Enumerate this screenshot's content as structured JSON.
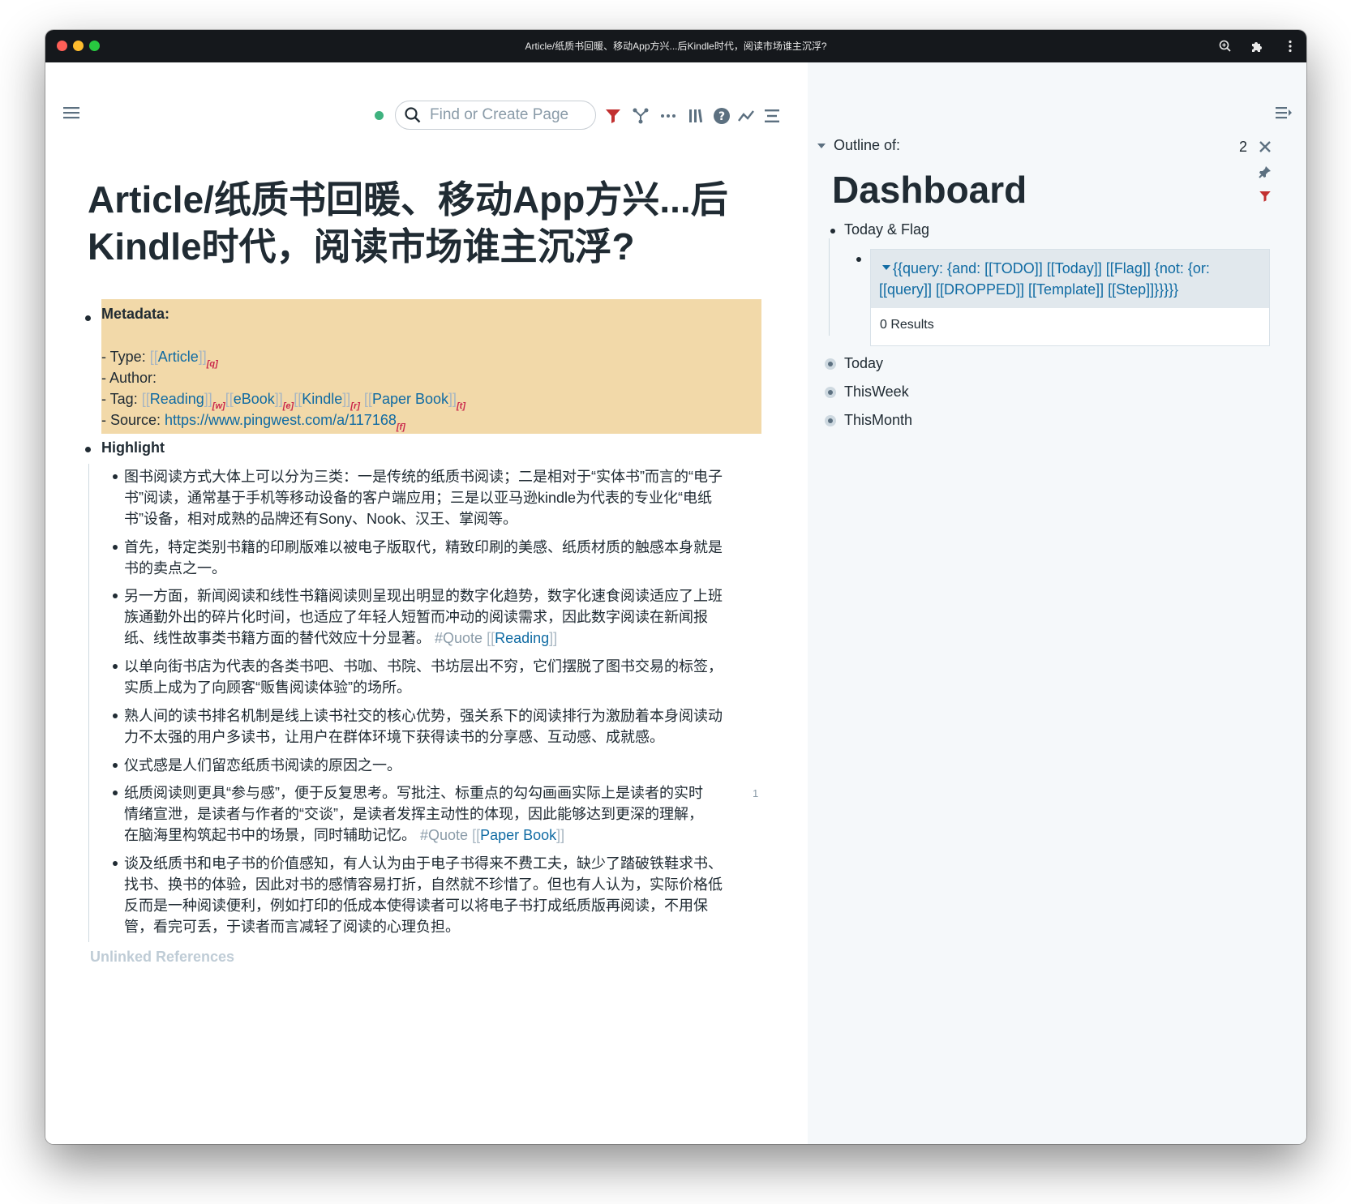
{
  "window": {
    "title": "Article/纸质书回暖、移动App方兴...后Kindle时代，阅读市场谁主沉浮?"
  },
  "topbar": {
    "search_placeholder": "Find or Create Page",
    "status_color": "#3fb27f",
    "filter_color": "#c23030"
  },
  "page": {
    "title": "Article/纸质书回暖、移动App方兴...后Kindle时代，阅读市场谁主沉浮?",
    "metadata": {
      "label": "Metadata:",
      "type_prefix": "- Type: ",
      "type_value": "Article",
      "type_note": "[q]",
      "author": "- Author:",
      "tag_prefix": "- Tag: ",
      "tags": [
        {
          "name": "Reading",
          "note": "[w]"
        },
        {
          "name": "eBook",
          "note": "[e]"
        },
        {
          "name": "Kindle",
          "note": "[r]"
        },
        {
          "name": "Paper Book",
          "note": "[t]"
        }
      ],
      "source_prefix": "- Source: ",
      "source_url": "https://www.pingwest.com/a/117168",
      "source_note": "[f]"
    },
    "highlight_label": "Highlight",
    "items": [
      {
        "text": "图书阅读方式大体上可以分为三类：一是传统的纸质书阅读；二是相对于“实体书”而言的“电子书”阅读，通常基于手机等移动设备的客户端应用；三是以亚马逊kindle为代表的专业化“电纸书”设备，相对成熟的品牌还有Sony、Nook、汉王、掌阅等。"
      },
      {
        "text": "首先，特定类别书籍的印刷版难以被电子版取代，精致印刷的美感、纸质材质的触感本身就是书的卖点之一。"
      },
      {
        "text": "另一方面，新闻阅读和线性书籍阅读则呈现出明显的数字化趋势，数字化速食阅读适应了上班族通勤外出的碎片化时间，也适应了年轻人短暂而冲动的阅读需求，因此数字阅读在新闻报纸、线性故事类书籍方面的替代效应十分显著。",
        "tag": "#Quote",
        "link": "Reading"
      },
      {
        "text": "以单向街书店为代表的各类书吧、书咖、书院、书坊层出不穷，它们摆脱了图书交易的标签，实质上成为了向顾客“贩售阅读体验”的场所。"
      },
      {
        "text": "熟人间的读书排名机制是线上读书社交的核心优势，强关系下的阅读排行为激励着本身阅读动力不太强的用户多读书，让用户在群体环境下获得读书的分享感、互动感、成就感。"
      },
      {
        "text": "仪式感是人们留恋纸质书阅读的原因之一。"
      },
      {
        "text": "纸质阅读则更具“参与感”，便于反复思考。写批注、标重点的勾勾画画实际上是读者的实时情绪宣泄，是读者与作者的“交谈”，是读者发挥主动性的体现，因此能够达到更深的理解，在脑海里构筑起书中的场景，同时辅助记忆。",
        "tag": "#Quote",
        "link": "Paper Book",
        "count": "1"
      },
      {
        "text": "谈及纸质书和电子书的价值感知，有人认为由于电子书得来不费工夫，缺少了踏破铁鞋求书、找书、换书的体验，因此对书的感情容易打折，自然就不珍惜了。但也有人认为，实际价格低反而是一种阅读便利，例如打印的低成本使得读者可以将电子书打成纸质版再阅读，不用保管，看完可丢，于读者而言减轻了阅读的心理负担。"
      }
    ],
    "unlinked_references": "Unlinked References"
  },
  "sidebar": {
    "outline_label": "Outline of:",
    "count": "2",
    "title": "Dashboard",
    "today_flag": "Today & Flag",
    "query_text": "{{query:  {and: [[TODO]] [[Today]] [[Flag]] {not: {or: [[query]] [[DROPPED]] [[Template]] [[Step]]}}}}}",
    "query_results": "0 Results",
    "children": [
      "Today",
      "ThisWeek",
      "ThisMonth"
    ]
  }
}
